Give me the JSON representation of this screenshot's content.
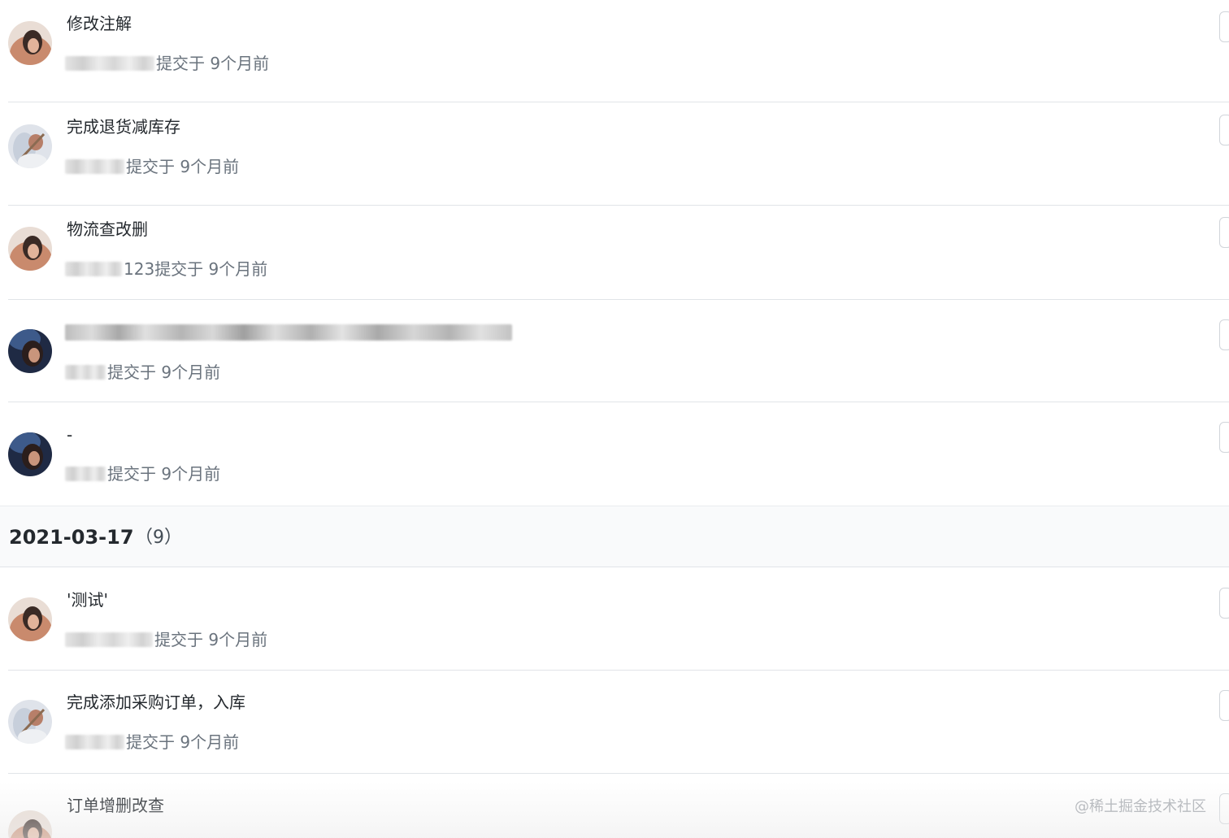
{
  "commits_before": [
    {
      "title": "修改注解",
      "author_visible": "",
      "meta": "提交于 9个月前",
      "avatar": "brunette-avatar"
    },
    {
      "title": "完成退货减库存",
      "author_visible": "",
      "meta": "提交于 9个月前",
      "avatar": "light-avatar"
    },
    {
      "title": "物流查改删",
      "author_visible": "123",
      "meta": " 提交于 9个月前",
      "avatar": "brunette-avatar"
    },
    {
      "title": "",
      "author_visible": "",
      "meta": " 提交于 9个月前",
      "avatar": "dark-avatar"
    },
    {
      "title": "-",
      "author_visible": "",
      "meta": " 提交于 9个月前",
      "avatar": "dark-avatar"
    }
  ],
  "date_group": {
    "date": "2021-03-17",
    "count": "（9）"
  },
  "commits_after": [
    {
      "title": "'测试'",
      "author_visible": "",
      "meta": " 提交于 9个月前",
      "avatar": "brunette-avatar"
    },
    {
      "title": "完成添加采购订单，入库",
      "author_visible": "",
      "meta": "提交于 9个月前",
      "avatar": "light-avatar"
    },
    {
      "title": "订单增删改查",
      "author_visible": "",
      "meta": "",
      "avatar": "brunette-avatar"
    }
  ],
  "watermark": "@稀土掘金技术社区"
}
